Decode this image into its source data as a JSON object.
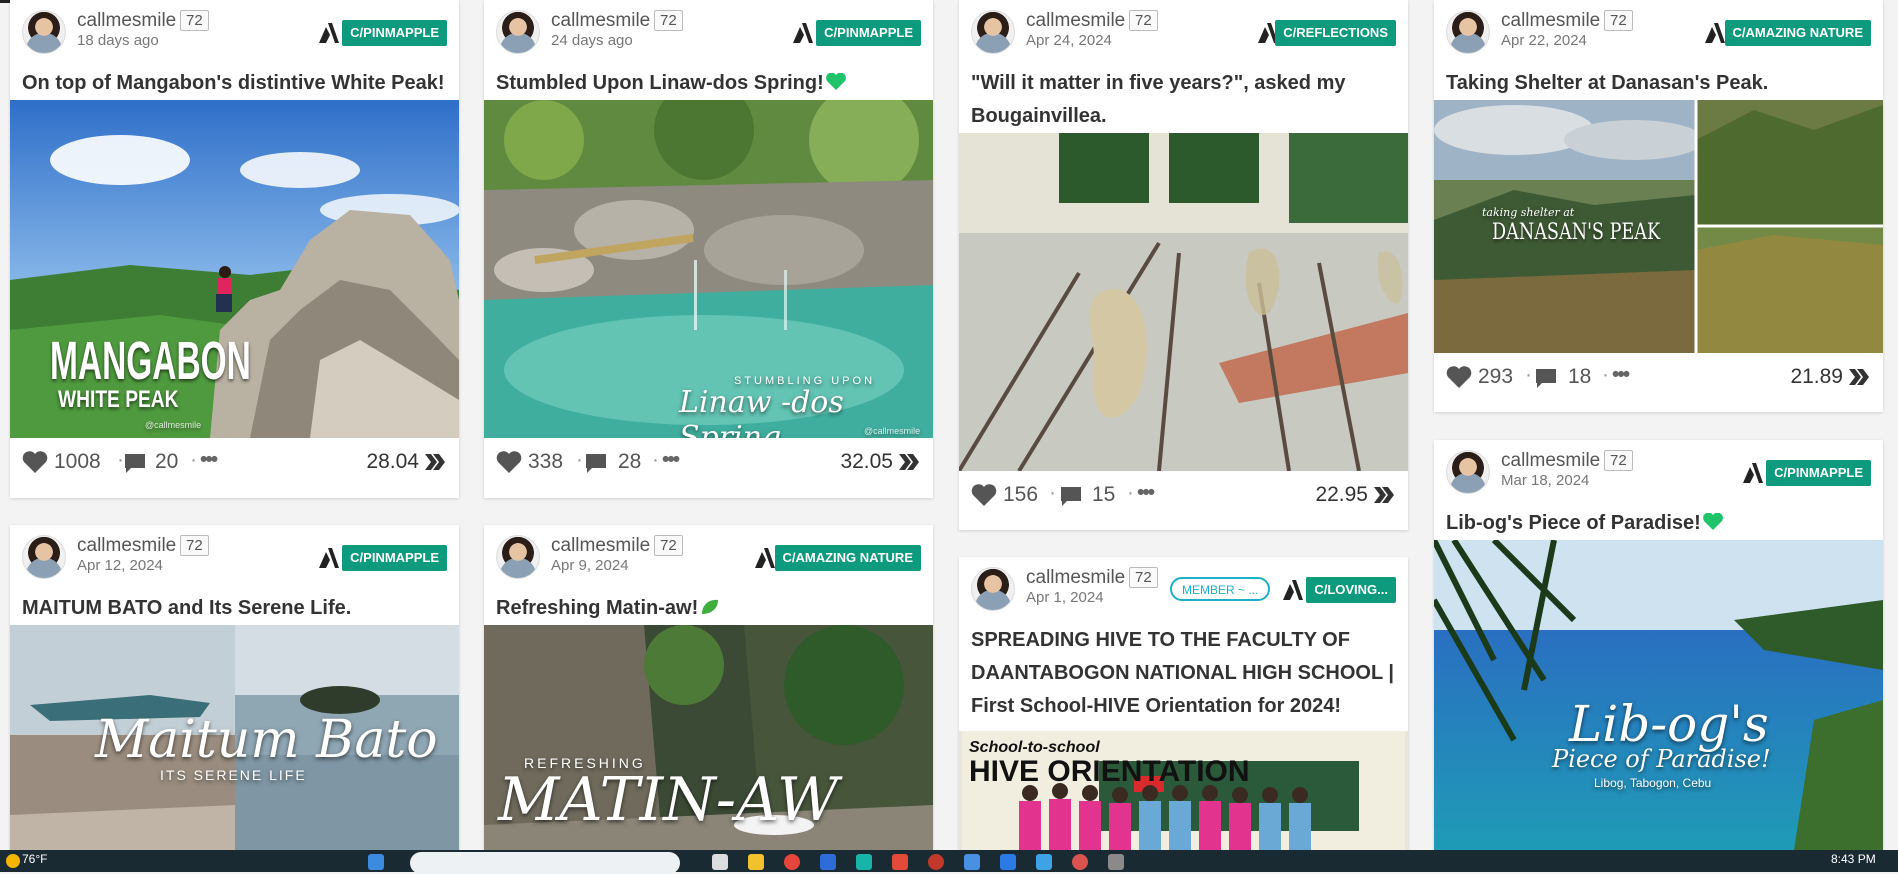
{
  "posts": [
    {
      "author": "callmesmile",
      "rep": "72",
      "date": "18 days ago",
      "community": "C/PINMAPPLE",
      "title": "On top of Mangabon's distintive White Peak!",
      "votes": "1008",
      "comments": "20",
      "payout": "28.04",
      "overlay1": "MANGABON",
      "overlay2": "WHITE PEAK",
      "watermark": "@callmesmile"
    },
    {
      "author": "callmesmile",
      "rep": "72",
      "date": "24 days ago",
      "community": "C/PINMAPPLE",
      "title": "Stumbled Upon Linaw-dos Spring!",
      "votes": "338",
      "comments": "28",
      "payout": "32.05",
      "overlay1": "STUMBLING UPON",
      "overlay2": "Linaw -dos Spring",
      "watermark": "@callmesmile"
    },
    {
      "author": "callmesmile",
      "rep": "72",
      "date": "Apr 24, 2024",
      "community": "C/REFLECTIONS",
      "title": "\"Will it matter in five years?\", asked my Bougainvillea.",
      "votes": "156",
      "comments": "15",
      "payout": "22.95"
    },
    {
      "author": "callmesmile",
      "rep": "72",
      "date": "Apr 22, 2024",
      "community": "C/AMAZING NATURE",
      "title": "Taking Shelter at Danasan's Peak.",
      "votes": "293",
      "comments": "18",
      "payout": "21.89",
      "overlay1": "taking shelter at",
      "overlay2": "DANASAN'S PEAK"
    },
    {
      "author": "callmesmile",
      "rep": "72",
      "date": "Apr 12, 2024",
      "community": "C/PINMAPPLE",
      "title": "MAITUM BATO and Its Serene Life.",
      "overlay1": "Maitum Bato",
      "overlay2": "ITS SERENE LIFE"
    },
    {
      "author": "callmesmile",
      "rep": "72",
      "date": "Apr 9, 2024",
      "community": "C/AMAZING NATURE",
      "title": "Refreshing Matin-aw!",
      "overlay1": "REFRESHING",
      "overlay2": "MATIN-AW"
    },
    {
      "author": "callmesmile",
      "rep": "72",
      "date": "Apr 1, 2024",
      "community": "C/LOVING...",
      "member": "MEMBER ~ ...",
      "title": "SPREADING HIVE TO THE FACULTY OF DAANTABOGON NATIONAL HIGH SCHOOL | First School-HIVE Orientation for 2024!",
      "overlay1": "School-to-school",
      "overlay2": "HIVE ORIENTATION"
    },
    {
      "author": "callmesmile",
      "rep": "72",
      "date": "Mar 18, 2024",
      "community": "C/PINMAPPLE",
      "title": "Lib-og's Piece of Paradise!",
      "overlay1": "Lib-og's",
      "overlay2": "Piece of Paradise!",
      "overlay3": "Libog, Tabogon, Cebu"
    }
  ],
  "taskbar": {
    "weather": "76°F",
    "time": "8:43 PM"
  },
  "colors": {
    "community": "#0d9a7d",
    "member": "#1ab0c8"
  },
  "icons": {
    "hive": "hive-logo-icon",
    "heart": "heart-icon",
    "comment": "comment-icon",
    "more": "more-icon"
  }
}
